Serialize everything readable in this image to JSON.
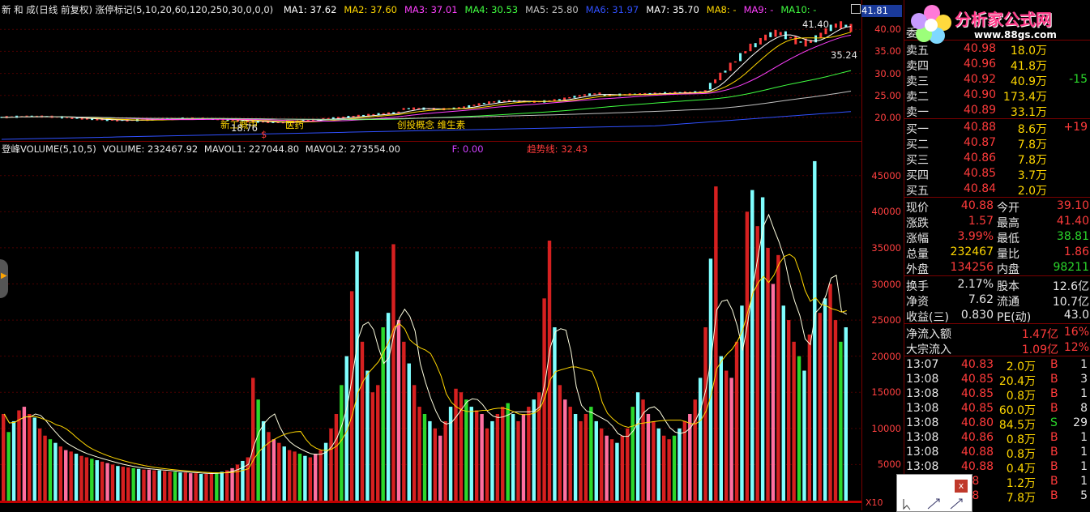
{
  "header": {
    "title": "新 和 成(日线 前复权) 涨停标记(5,10,20,60,120,250,30,0,0,0)",
    "ma": [
      {
        "label": "MA1: 37.62",
        "color": "#ffffff"
      },
      {
        "label": "MA2: 37.60",
        "color": "#ffd700"
      },
      {
        "label": "MA3: 37.01",
        "color": "#ff40ff"
      },
      {
        "label": "MA4: 30.53",
        "color": "#40ff40"
      },
      {
        "label": "MA5: 25.80",
        "color": "#c0c0c0"
      },
      {
        "label": "MA6: 31.97",
        "color": "#3050ff"
      },
      {
        "label": "MA7: 35.70",
        "color": "#ffffff"
      },
      {
        "label": "MA8: -",
        "color": "#ffd700"
      },
      {
        "label": "MA9: -",
        "color": "#ff40ff"
      },
      {
        "label": "MA10: -",
        "color": "#40ff40"
      }
    ]
  },
  "price_chart": {
    "high_label": "41.40",
    "low_label": "35.24",
    "annotations": [
      "新工概中",
      "医药",
      "创投概念 维生素",
      "18.76",
      "$"
    ],
    "axis_ticks": [
      "40.00",
      "35.00",
      "30.00",
      "25.00",
      "20.00"
    ],
    "current_price": "41.81"
  },
  "volume_chart": {
    "header_name": "登峰VOLUME(5,10,5)",
    "volume": "VOLUME: 232467.92",
    "mavol1": "MAVOL1: 227044.80",
    "mavol2": "MAVOL2: 273554.00",
    "f_value": "F: 0.00",
    "trend": "趋势线: 32.43",
    "axis_ticks": [
      "45000",
      "40000",
      "35000",
      "30000",
      "25000",
      "20000",
      "15000",
      "10000",
      "5000"
    ],
    "bottom_label": "X10"
  },
  "chart_data": {
    "type": "bar",
    "title": "",
    "xlabel": "",
    "ylabel": "",
    "ylim": [
      0,
      48000
    ],
    "series": [
      {
        "name": "VOLUME",
        "values": [
          12000,
          9500,
          11000,
          12500,
          13000,
          12000,
          11500,
          10000,
          9000,
          8500,
          8000,
          7500,
          7000,
          6800,
          6500,
          6200,
          6000,
          5800,
          5600,
          5400,
          5200,
          5000,
          4800,
          4700,
          4600,
          4500,
          4400,
          4300,
          4300,
          4200,
          4200,
          4100,
          4000,
          4000,
          3900,
          3900,
          3800,
          3800,
          3700,
          3700,
          3800,
          3900,
          4000,
          4200,
          4500,
          5000,
          5500,
          6000,
          17000,
          14000,
          11000,
          9500,
          8500,
          8000,
          7500,
          7000,
          6800,
          6500,
          6200,
          6000,
          6500,
          7000,
          8000,
          10000,
          12000,
          16000,
          20000,
          29000,
          34500,
          22000,
          18000,
          15000,
          16000,
          24000,
          26000,
          35500,
          25000,
          22000,
          19000,
          16000,
          13000,
          12000,
          11000,
          10000,
          9000,
          11000,
          13000,
          15500,
          15000,
          14000,
          13000,
          12500,
          12000,
          10000,
          11000,
          12000,
          13000,
          13500,
          12000,
          11000,
          12000,
          13000,
          14000,
          15000,
          28000,
          36000,
          24000,
          16000,
          14000,
          13000,
          12000,
          11000,
          12000,
          13000,
          11000,
          10000,
          9000,
          8500,
          8000,
          9000,
          10000,
          13000,
          15000,
          14000,
          12000,
          11000,
          10000,
          9000,
          8500,
          9000,
          10000,
          11000,
          12000,
          14000,
          17000,
          24000,
          33500,
          43500,
          20000,
          18000,
          17000,
          22000,
          27000,
          40000,
          43000,
          38000,
          42000,
          35000,
          30000,
          34000,
          27000,
          25000,
          22000,
          20000,
          18000,
          23000,
          47000,
          26000,
          28000,
          30000,
          25000,
          22000,
          24000
        ]
      }
    ]
  },
  "quote": {
    "weibi_label": "委比",
    "sell": [
      {
        "label": "卖五",
        "price": "40.98",
        "vol": "18.0万"
      },
      {
        "label": "卖四",
        "price": "40.96",
        "vol": "41.8万"
      },
      {
        "label": "卖三",
        "price": "40.92",
        "vol": "40.9万"
      },
      {
        "label": "卖二",
        "price": "40.90",
        "vol": "173.4万"
      },
      {
        "label": "卖一",
        "price": "40.89",
        "vol": "33.1万"
      }
    ],
    "sell_change": "-15",
    "buy": [
      {
        "label": "买一",
        "price": "40.88",
        "vol": "8.6万"
      },
      {
        "label": "买二",
        "price": "40.87",
        "vol": "7.8万"
      },
      {
        "label": "买三",
        "price": "40.86",
        "vol": "7.8万"
      },
      {
        "label": "买四",
        "price": "40.85",
        "vol": "3.7万"
      },
      {
        "label": "买五",
        "price": "40.84",
        "vol": "2.0万"
      }
    ],
    "buy_change": "+19",
    "stats": [
      {
        "l1": "现价",
        "v1": "40.88",
        "c1": "red",
        "l2": "今开",
        "v2": "39.10",
        "c2": "red"
      },
      {
        "l1": "涨跌",
        "v1": "1.57",
        "c1": "red",
        "l2": "最高",
        "v2": "41.40",
        "c2": "red"
      },
      {
        "l1": "涨幅",
        "v1": "3.99%",
        "c1": "red",
        "l2": "最低",
        "v2": "38.81",
        "c2": "green"
      },
      {
        "l1": "总量",
        "v1": "232467",
        "c1": "yellow",
        "l2": "量比",
        "v2": "1.86",
        "c2": "red"
      },
      {
        "l1": "外盘",
        "v1": "134256",
        "c1": "red",
        "l2": "内盘",
        "v2": "98211",
        "c2": "green"
      }
    ],
    "stats2": [
      {
        "l1": "换手",
        "v1": "2.17%",
        "l2": "股本",
        "v2": "12.6亿"
      },
      {
        "l1": "净资",
        "v1": "7.62",
        "l2": "流通",
        "v2": "10.7亿"
      },
      {
        "l1": "收益(三)",
        "v1": "0.830",
        "l2": "PE(动)",
        "v2": "43.0"
      }
    ],
    "flows": [
      {
        "label": "净流入额",
        "value": "1.47亿",
        "pct": "16%"
      },
      {
        "label": "大宗流入",
        "value": "1.09亿",
        "pct": "12%"
      }
    ],
    "ticks": [
      {
        "time": "13:07",
        "price": "40.83",
        "vol": "2.0万",
        "side": "B",
        "n": "1"
      },
      {
        "time": "13:08",
        "price": "40.85",
        "vol": "20.4万",
        "side": "B",
        "n": "3"
      },
      {
        "time": "13:08",
        "price": "40.85",
        "vol": "0.8万",
        "side": "B",
        "n": "1"
      },
      {
        "time": "13:08",
        "price": "40.85",
        "vol": "60.0万",
        "side": "B",
        "n": "8"
      },
      {
        "time": "13:08",
        "price": "40.80",
        "vol": "84.5万",
        "side": "S",
        "n": "29"
      },
      {
        "time": "13:08",
        "price": "40.86",
        "vol": "0.8万",
        "side": "B",
        "n": "1"
      },
      {
        "time": "13:08",
        "price": "40.88",
        "vol": "0.8万",
        "side": "B",
        "n": "1"
      },
      {
        "time": "13:08",
        "price": "40.88",
        "vol": "0.4万",
        "side": "B",
        "n": "1"
      },
      {
        "time": "13:08",
        "price": ".88",
        "vol": "1.2万",
        "side": "B",
        "n": "1"
      },
      {
        "time": "13:08",
        "price": ".88",
        "vol": "7.8万",
        "side": "B",
        "n": "5"
      }
    ]
  },
  "logo": {
    "text": "分析家公式网",
    "url_text": "www.88gs.com"
  },
  "mini_window": {
    "close_label": "x"
  },
  "colors": {
    "up": "#ff3b3b",
    "down": "#2bd82b",
    "cyan": "#7fffff",
    "grid": "#7a0000"
  }
}
